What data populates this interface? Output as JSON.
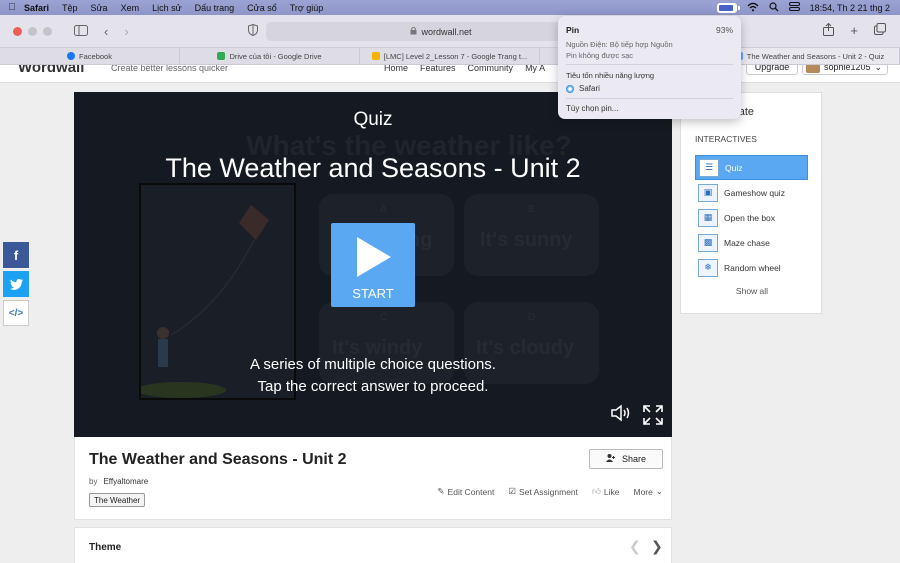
{
  "menubar": {
    "app": "Safari",
    "items": [
      "Tệp",
      "Sửa",
      "Xem",
      "Lịch sử",
      "Dấu trang",
      "Cửa sổ",
      "Trợ giúp"
    ],
    "clock": "18:54, Th 2 21 thg 2"
  },
  "browser": {
    "url": "wordwall.net",
    "tabs": [
      {
        "label": "Facebook",
        "color": "#1877f2"
      },
      {
        "label": "Drive của tôi - Google Drive",
        "color": "#34a853"
      },
      {
        "label": "[LMC] Level 2_Lesson 7 - Google Trang t...",
        "color": "#f4b400"
      },
      {
        "label": "",
        "color": "#dedde6"
      },
      {
        "label": "The Weather and Seasons - Unit 2 - Quiz",
        "color": "#5aa8f2"
      }
    ]
  },
  "site": {
    "logo": "Wordwall",
    "tagline": "Create better lessons quicker",
    "nav": [
      "Home",
      "Features",
      "Community",
      "My A"
    ],
    "upgrade": "Upgrade",
    "username": "sophie1205"
  },
  "player": {
    "bg_question": "What's the weather like?",
    "ghost_answers": [
      {
        "letter": "A",
        "text": "It's raining"
      },
      {
        "letter": "B",
        "text": "It's sunny"
      },
      {
        "letter": "C",
        "text": "It's windy"
      },
      {
        "letter": "D",
        "text": "It's cloudy"
      }
    ],
    "type": "Quiz",
    "title": "The Weather and Seasons - Unit 2",
    "start": "START",
    "desc1": "A series of multiple choice questions.",
    "desc2": "Tap the correct answer to proceed."
  },
  "activity": {
    "title": "The Weather and Seasons - Unit 2",
    "by": "by",
    "author": "Effyaltomare",
    "tag": "The Weather",
    "share": "Share",
    "actions": {
      "edit": "Edit Content",
      "assign": "Set Assignment",
      "like": "Like",
      "more": "More"
    }
  },
  "theme": {
    "label": "Theme"
  },
  "sidebar": {
    "template_label": "mplate",
    "header": "INTERACTIVES",
    "items": [
      {
        "label": "Quiz",
        "icon": "quiz-icon"
      },
      {
        "label": "Gameshow quiz",
        "icon": "gameshow-icon"
      },
      {
        "label": "Open the box",
        "icon": "box-icon"
      },
      {
        "label": "Maze chase",
        "icon": "maze-icon"
      },
      {
        "label": "Random wheel",
        "icon": "wheel-icon"
      }
    ],
    "show_all": "Show all"
  },
  "battery_popup": {
    "title": "Pin",
    "percent": "93%",
    "source": "Nguồn Điện: Bộ tiếp hợp Nguồn",
    "status": "Pin không được sạc",
    "heavy_label": "Tiêu tốn nhiều năng lượng",
    "heavy_app": "Safari",
    "options": "Tùy chọn pin..."
  },
  "colors": {
    "accent": "#5aa8f2",
    "facebook": "#3b5998",
    "twitter": "#1da1f2"
  }
}
